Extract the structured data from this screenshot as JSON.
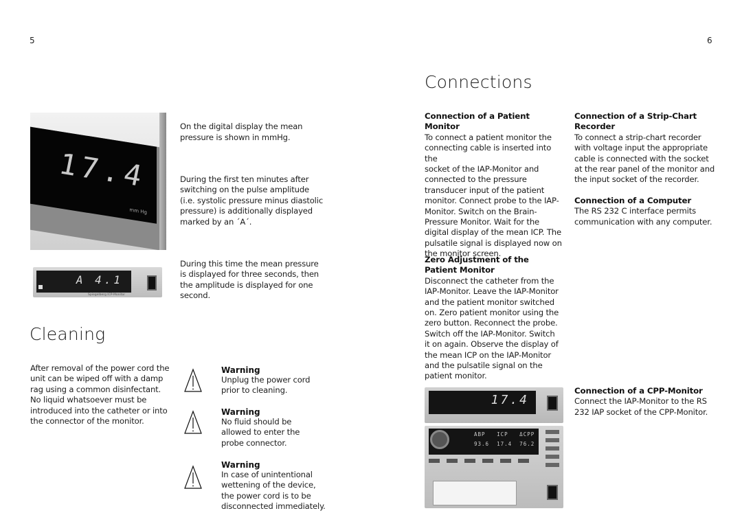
{
  "left_page": {
    "page_number": "5",
    "intro_paragraphs": [
      "On the digital display the mean\npressure is shown in mmHg.",
      "During the first ten minutes after\nswitching on the pulse amplitude\n(i.e. systolic pressure minus diastolic\npressure) is additionally displayed\nmarked by an ´A´.",
      "During this time the mean pressure\nis displayed for three seconds, then\nthe amplitude is displayed for one\nsecond."
    ],
    "photo_display": {
      "reading": "17.4",
      "unit": "mm Hg"
    },
    "photo_monitor": {
      "reading": "A 4.1",
      "brand_label": "Spiegelberg ICP-Monitor"
    },
    "cleaning": {
      "title": "Cleaning",
      "body": "After removal of the power cord the\nunit can be wiped off with a damp\nrag using a common disinfectant.\nNo liquid whatsoever must be\nintroduced into the catheter or into\nthe connector of the monitor.",
      "warnings": [
        {
          "icon": "warning-triangle-icon",
          "title": "Warning",
          "text": "Unplug the power cord\nprior to cleaning."
        },
        {
          "icon": "warning-triangle-icon",
          "title": "Warning",
          "text": "No fluid should be\nallowed to enter the\nprobe connector."
        },
        {
          "icon": "warning-triangle-icon",
          "title": "Warning",
          "text": "In case of unintentional\nwettening of the device,\nthe power cord is to be\ndisconnected immediately."
        }
      ]
    }
  },
  "right_page": {
    "page_number": "6",
    "title": "Connections",
    "sections": {
      "patient_monitor": {
        "heading": "Connection of a Patient\nMonitor",
        "body": "To connect a patient monitor the\nconnecting cable is inserted into the\nsocket of the IAP-Monitor and\nconnected to the pressure\ntransducer input of the patient\nmonitor. Connect probe to the IAP-\nMonitor. Switch on the Brain-\nPressure Monitor. Wait for the\ndigital display of the mean ICP. The\npulsatile signal is displayed now on\nthe monitor screen."
      },
      "zero_adjustment": {
        "heading": "Zero Adjustment of the\nPatient Monitor",
        "body": "Disconnect the catheter from the\nIAP-Monitor. Leave the IAP-Monitor\nand the patient monitor switched\non. Zero patient monitor using the\nzero button. Reconnect the probe.\nSwitch off the IAP-Monitor. Switch\nit on again. Observe the display of\nthe mean ICP on the IAP-Monitor\nand the pulsatile signal on the\npatient monitor."
      },
      "strip_chart": {
        "heading": "Connection of a Strip-Chart\nRecorder",
        "body": "To connect a strip-chart recorder\nwith voltage input the appropriate\ncable is connected with the socket\nat the rear panel of the monitor and\nthe input socket of the recorder."
      },
      "computer": {
        "heading": "Connection of a Computer",
        "body": "The RS 232 C interface permits\ncommunication with any computer."
      },
      "cpp_monitor": {
        "heading": "Connection of a CPP-Monitor",
        "body": "Connect the IAP-Monitor to the RS\n232 IAP socket of the CPP-Monitor."
      }
    },
    "photo_combo": {
      "top_reading": "17.4",
      "labels": "ABP   ICP   ΔCPP",
      "values": "93.6  17.4  76.2"
    }
  }
}
